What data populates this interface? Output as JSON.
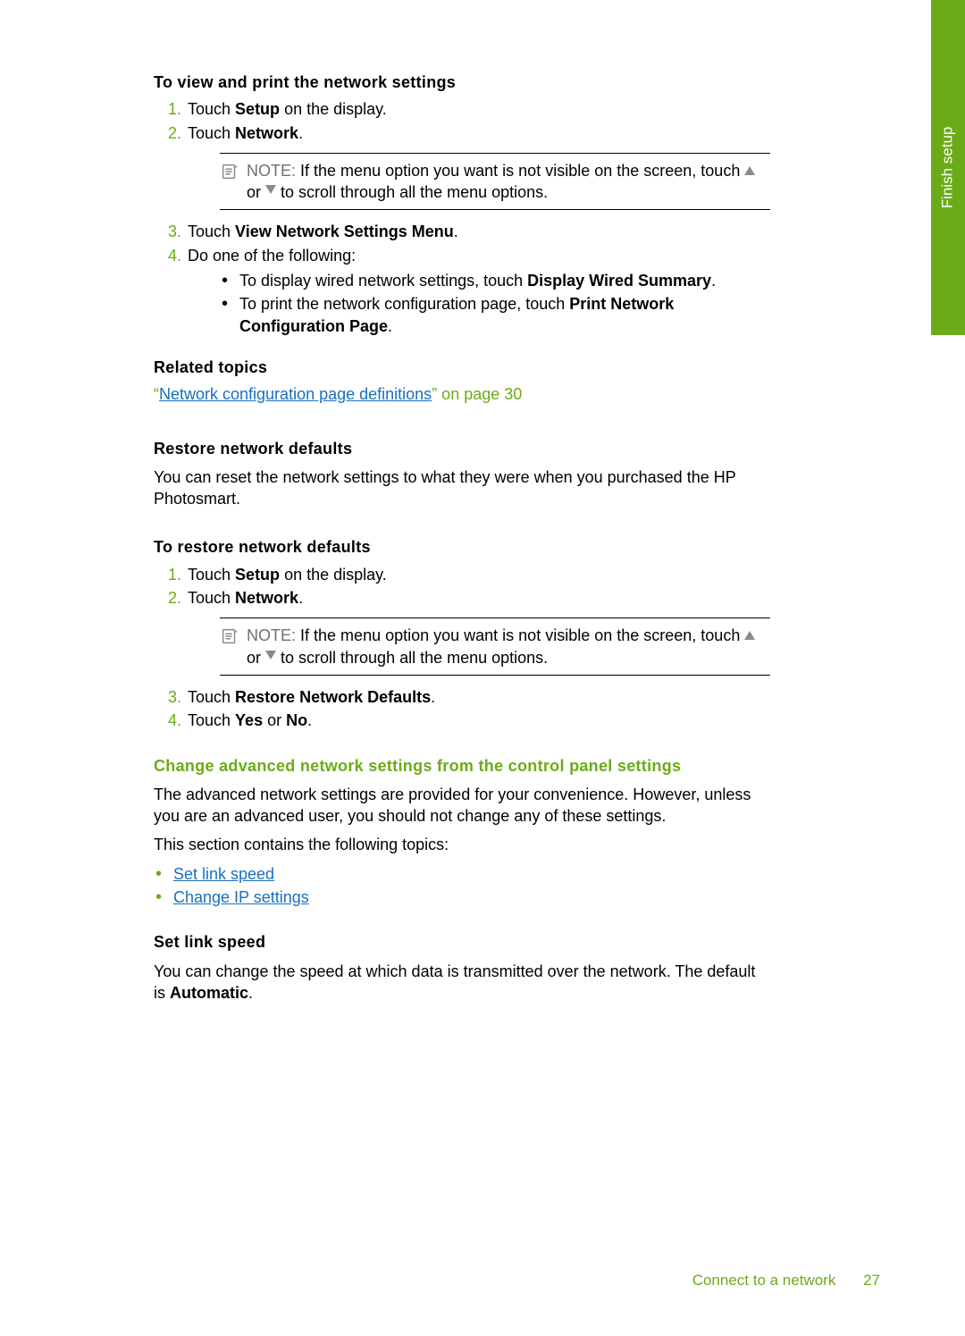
{
  "side_tab": "Finish setup",
  "view_print": {
    "title": "To view and print the network settings",
    "steps": {
      "s1_pre": "Touch ",
      "s1_bold": "Setup",
      "s1_post": " on the display.",
      "s2_pre": "Touch ",
      "s2_bold": "Network",
      "s2_post": ".",
      "note_label": "NOTE:",
      "note_a": "If the menu option you want is not visible on the screen, touch ",
      "note_b": " or ",
      "note_c": " to scroll through all the menu options.",
      "s3_pre": "Touch ",
      "s3_bold": "View Network Settings Menu",
      "s3_post": ".",
      "s4": "Do one of the following:",
      "s4_b1_pre": "To display wired network settings, touch ",
      "s4_b1_bold": "Display Wired Summary",
      "s4_b1_post": ".",
      "s4_b2_pre": "To print the network configuration page, touch ",
      "s4_b2_bold": "Print Network Configuration Page",
      "s4_b2_post": "."
    }
  },
  "related": {
    "title": "Related topics",
    "quote_open": "“",
    "link_text": "Network configuration page definitions",
    "quote_close": "” on page 30"
  },
  "restore": {
    "heading": "Restore network defaults",
    "para": "You can reset the network settings to what they were when you purchased the HP Photosmart.",
    "title": "To restore network defaults",
    "steps": {
      "s1_pre": "Touch ",
      "s1_bold": "Setup",
      "s1_post": " on the display.",
      "s2_pre": "Touch ",
      "s2_bold": "Network",
      "s2_post": ".",
      "note_label": "NOTE:",
      "note_a": "If the menu option you want is not visible on the screen, touch ",
      "note_b": " or ",
      "note_c": " to scroll through all the menu options.",
      "s3_pre": "Touch ",
      "s3_bold": "Restore Network Defaults",
      "s3_post": ".",
      "s4_pre": "Touch ",
      "s4_bold1": "Yes",
      "s4_mid": " or ",
      "s4_bold2": "No",
      "s4_post": "."
    }
  },
  "advanced": {
    "heading": "Change advanced network settings from the control panel settings",
    "para1": "The advanced network settings are provided for your convenience. However, unless you are an advanced user, you should not change any of these settings.",
    "para2": "This section contains the following topics:",
    "links": {
      "l1": "Set link speed",
      "l2": "Change IP settings"
    }
  },
  "link_speed": {
    "heading": "Set link speed",
    "para_pre": "You can change the speed at which data is transmitted over the network. The default is ",
    "para_bold": "Automatic",
    "para_post": "."
  },
  "footer": {
    "section": "Connect to a network",
    "page": "27"
  }
}
